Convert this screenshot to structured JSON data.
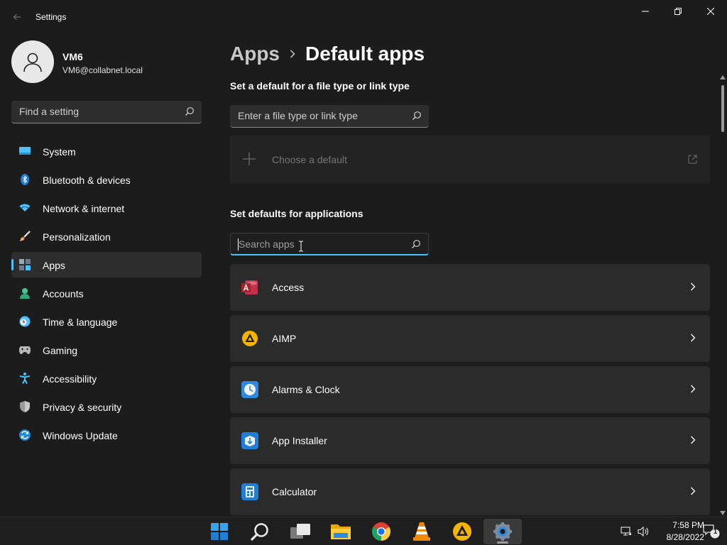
{
  "window": {
    "title": "Settings",
    "controls": {
      "minimize": "minimize-icon",
      "maximize": "restore-icon",
      "close": "close-icon"
    }
  },
  "profile": {
    "name": "VM6",
    "email": "VM6@collabnet.local"
  },
  "sidebar": {
    "search_placeholder": "Find a setting",
    "items": [
      {
        "label": "System",
        "icon": "system-icon",
        "selected": false
      },
      {
        "label": "Bluetooth & devices",
        "icon": "bluetooth-icon",
        "selected": false
      },
      {
        "label": "Network & internet",
        "icon": "wifi-icon",
        "selected": false
      },
      {
        "label": "Personalization",
        "icon": "brush-icon",
        "selected": false
      },
      {
        "label": "Apps",
        "icon": "apps-icon",
        "selected": true
      },
      {
        "label": "Accounts",
        "icon": "accounts-icon",
        "selected": false
      },
      {
        "label": "Time & language",
        "icon": "clock-globe-icon",
        "selected": false
      },
      {
        "label": "Gaming",
        "icon": "gamepad-icon",
        "selected": false
      },
      {
        "label": "Accessibility",
        "icon": "accessibility-icon",
        "selected": false
      },
      {
        "label": "Privacy & security",
        "icon": "shield-icon",
        "selected": false
      },
      {
        "label": "Windows Update",
        "icon": "update-icon",
        "selected": false
      }
    ]
  },
  "header": {
    "parent": "Apps",
    "current": "Default apps"
  },
  "filetype": {
    "title": "Set a default for a file type or link type",
    "placeholder": "Enter a file type or link type",
    "choose_label": "Choose a default"
  },
  "apps_section": {
    "title": "Set defaults for applications",
    "placeholder": "Search apps",
    "apps": [
      {
        "name": "Access",
        "icon": "access-icon"
      },
      {
        "name": "AIMP",
        "icon": "aimp-icon"
      },
      {
        "name": "Alarms & Clock",
        "icon": "alarms-clock-icon"
      },
      {
        "name": "App Installer",
        "icon": "app-installer-icon"
      },
      {
        "name": "Calculator",
        "icon": "calculator-icon"
      }
    ]
  },
  "taskbar": {
    "items": [
      "start-icon",
      "search-icon",
      "task-view-icon",
      "file-explorer-icon",
      "chrome-icon",
      "vlc-icon",
      "aimp-icon",
      "settings-icon"
    ],
    "active_item": "settings-icon",
    "time": "7:58 PM",
    "date": "8/28/2022",
    "notification_count": "1"
  },
  "colors": {
    "accent": "#4cc2ff",
    "background": "#1c1c1c",
    "card": "#2b2b2b"
  }
}
